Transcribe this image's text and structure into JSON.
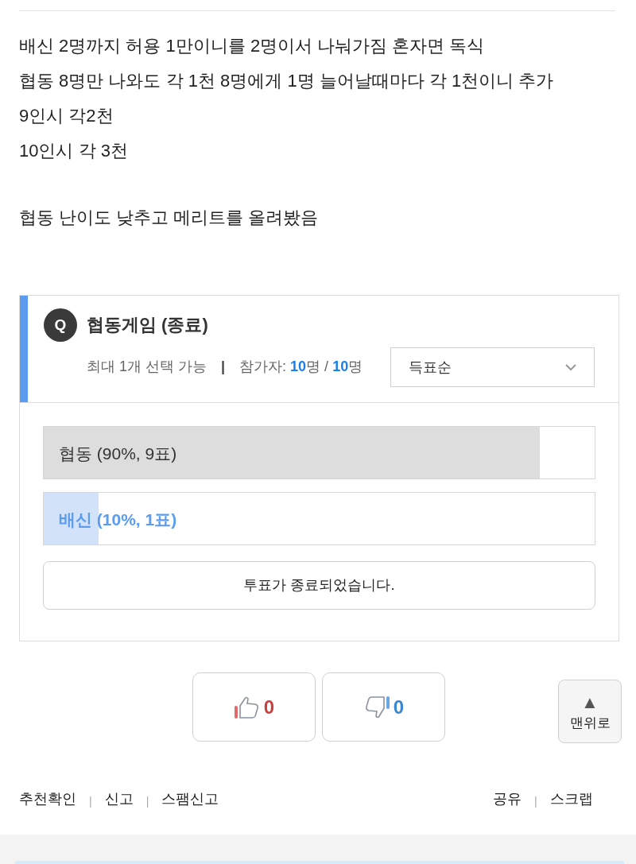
{
  "post": {
    "paragraphs": [
      [
        "배신 2명까지 허용 1만이니를 2명이서 나눠가짐 혼자면 독식",
        "협동 8명만 나와도 각 1천 8명에게 1명 늘어날때마다 각 1천이니 추가",
        "9인시 각2천",
        "10인시 각 3천"
      ],
      [
        "협동 난이도 낮추고 메리트를 올려봤음"
      ]
    ]
  },
  "poll": {
    "badge": "Q",
    "title": "협동게임 (종료)",
    "limit": "최대 1개 선택 가능",
    "separator": "|",
    "participants": {
      "label": "참가자:",
      "current": "10",
      "current_unit": "명",
      "slash": "/",
      "max": "10",
      "max_unit": "명"
    },
    "sort": {
      "value": "득표순"
    },
    "options": [
      {
        "label": "협동 (90%, 9표)",
        "level": 0.9,
        "selected": false
      },
      {
        "label": "배신 (10%, 1표)",
        "level": 0.1,
        "selected": true
      }
    ],
    "status_button": "투표가 종료되었습니다."
  },
  "votes": {
    "up": "0",
    "down": "0"
  },
  "top_button": {
    "icon": "▲",
    "label": "맨위로"
  },
  "footer": {
    "left": [
      "추천확인",
      "신고",
      "스팸신고"
    ],
    "right": [
      "공유",
      "스크랩"
    ],
    "separator": "|"
  }
}
